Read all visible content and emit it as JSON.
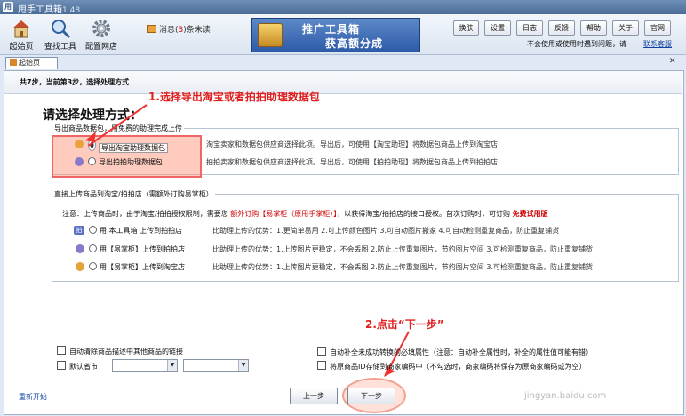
{
  "titlebar": {
    "icon_text": "用",
    "title": "甩手工具箱",
    "version": "1.48"
  },
  "toolbar": {
    "items": [
      {
        "label": "起始页"
      },
      {
        "label": "查找工具"
      },
      {
        "label": "配置网店"
      }
    ],
    "message": {
      "prefix": "消息(",
      "count": "3",
      "suffix": ")条未读"
    },
    "banner": {
      "line1": "推广工具箱",
      "line2": "获高额分成"
    },
    "buttons": [
      "换肤",
      "设置",
      "日志",
      "反馈",
      "帮助",
      "关于",
      "官网"
    ],
    "no_remind": "不会使用或使用时遇到问题，请",
    "contact": "联系客服"
  },
  "tab": {
    "label": "起始页",
    "close": "✕"
  },
  "step": {
    "text": "共7步，当前第3步，选择处理方式"
  },
  "heading": "请选择处理方式：",
  "group1": {
    "legend": "导出商品数据包，用免费的助理完成上传",
    "options": [
      {
        "label": "导出淘宝助理数据包",
        "desc": "淘宝卖家和数据包供应商选择此项。导出后，可使用【淘宝助理】将数据包商品上传到淘宝店"
      },
      {
        "label": "导出拍拍助理数据包",
        "desc": "拍拍卖家和数据包供应商选择此项。导出后，可使用【拍拍助理】将数据包商品上传到拍拍店"
      }
    ]
  },
  "group2": {
    "legend": "直接上传商品到淘宝/拍拍店（需额外订购易掌柜）",
    "note_a": "注意：上传商品时，由于淘宝/拍拍授权限制，需要您",
    "note_b": "额外订购【易掌柜（原甩手掌柜）】",
    "note_c": "，以获得淘宝/拍拍店的接口授权。首次订购时，可订购",
    "note_d": "免费试用版",
    "options": [
      {
        "label": "用 本工具箱 上传到拍拍店",
        "desc": "比助理上传的优势：1.更简单易用 2.可上传颜色图片 3.可自动图片搬家 4.可自动检测重复商品，防止重复铺货"
      },
      {
        "label": "用【易掌柜】上传到拍拍店",
        "desc": "比助理上传的优势：1.上传图片更稳定，不会丢图 2.防止上传重复图片，节约图片空间 3.可检测重复商品，防止重复铺货"
      },
      {
        "label": "用【易掌柜】上传到淘宝店",
        "desc": "比助理上传的优势：1.上传图片更稳定，不会丢图 2.防止上传重复图片，节约图片空间 3.可检测重复商品，防止重复铺货"
      }
    ]
  },
  "annotations": {
    "a1": "1.选择导出淘宝或者拍拍助理数据包",
    "a2": "2.点击“下一步”"
  },
  "bottom": {
    "opt1": "自动清除商品描述中其他商品的链接",
    "opt2": "默认省市",
    "opt3": "自动补全未成功转换的必填属性（注意：自动补全属性时，补全的属性值可能有错）",
    "opt4": "将原商品ID存储到商家编码中（不勾选时，商家编码将保存为原商家编码或为空）",
    "restart": "重新开始",
    "prev": "上一步",
    "next": "下一步"
  },
  "watermark": "jingyan.baidu.com"
}
